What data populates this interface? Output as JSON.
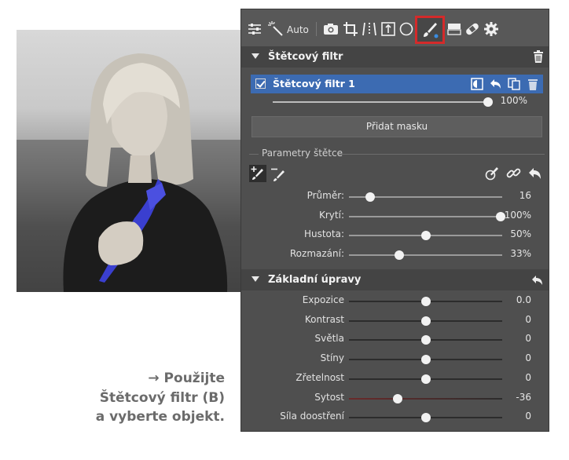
{
  "caption": {
    "line1": "→ Použijte",
    "line2": "Štětcový filtr (B)",
    "line3": "a vyberte objekt."
  },
  "toolbar": {
    "auto_label": "Auto",
    "icons": [
      "sliders-icon",
      "magic-wand-icon",
      "camera-icon",
      "crop-icon",
      "perspective-icon",
      "level-icon",
      "radial-icon",
      "brush-icon",
      "gradient-icon",
      "bandage-icon",
      "gear-icon"
    ],
    "selected": "brush-icon",
    "highlight_color": "#d42a2a"
  },
  "brush_filter_section": {
    "title": "Štětcový filtr",
    "filter": {
      "name": "Štětcový filtr 1",
      "checked": true,
      "opacity_value": "100%",
      "opacity": 1.0
    },
    "add_mask_label": "Přidat masku",
    "params_label": "Parametry štětce",
    "sliders": [
      {
        "label": "Průměr:",
        "value": "16",
        "fraction": 0.14
      },
      {
        "label": "Krytí:",
        "value": "100%",
        "fraction": 0.99
      },
      {
        "label": "Hustota:",
        "value": "50%",
        "fraction": 0.5
      },
      {
        "label": "Rozmazání:",
        "value": "33%",
        "fraction": 0.33
      }
    ]
  },
  "basic_section": {
    "title": "Základní úpravy",
    "sliders": [
      {
        "label": "Expozice",
        "value": "0.0",
        "fraction": 0.5
      },
      {
        "label": "Kontrast",
        "value": "0",
        "fraction": 0.5
      },
      {
        "label": "Světla",
        "value": "0",
        "fraction": 0.5
      },
      {
        "label": "Stíny",
        "value": "0",
        "fraction": 0.5
      },
      {
        "label": "Zřetelnost",
        "value": "0",
        "fraction": 0.5
      },
      {
        "label": "Sytost",
        "value": "-36",
        "fraction": 0.32
      },
      {
        "label": "Síla doostření",
        "value": "0",
        "fraction": 0.5
      }
    ]
  },
  "colors": {
    "panel_bg": "#4f4f4f",
    "selected_row": "#3c6bb2",
    "accent_blue": "#3a4fd8"
  }
}
